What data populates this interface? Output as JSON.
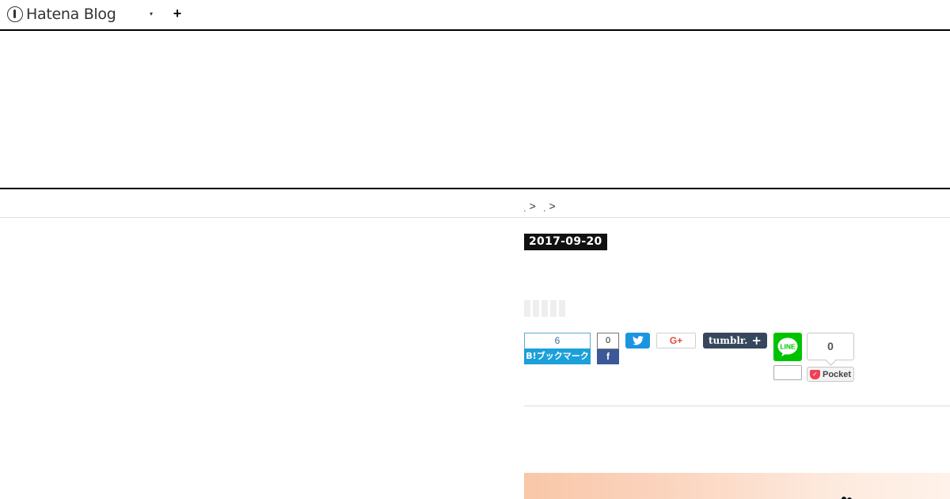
{
  "topbar": {
    "logo_text": "Hatena Blog",
    "logo_icon": "hatena-logo-icon",
    "menu_caret": "▾",
    "add_label": "+"
  },
  "breadcrumb": {
    "items": [
      {
        "label": "˛",
        "sep": ">"
      },
      {
        "label": "˛",
        "sep": ">"
      }
    ]
  },
  "entry": {
    "date": "2017-09-20"
  },
  "share": {
    "hatena_count": "6",
    "hatena_label": "B!ブックマーク",
    "facebook_count": "0",
    "facebook_icon": "f",
    "twitter_icon": "twitter-bird-icon",
    "googleplus_label": "G+",
    "tumblr_label": "tumblr.",
    "tumblr_plus": "+",
    "line_label": "LINE",
    "line_count": "",
    "pocket_count": "0",
    "pocket_label": "Pocket",
    "pocket_icon": "✓"
  },
  "colors": {
    "hatena": "#1ba0d9",
    "facebook": "#3b5998",
    "twitter": "#1b95e0",
    "googleplus": "#dd4b39",
    "tumblr": "#36465d",
    "line": "#00c300",
    "pocket": "#ee4056"
  }
}
